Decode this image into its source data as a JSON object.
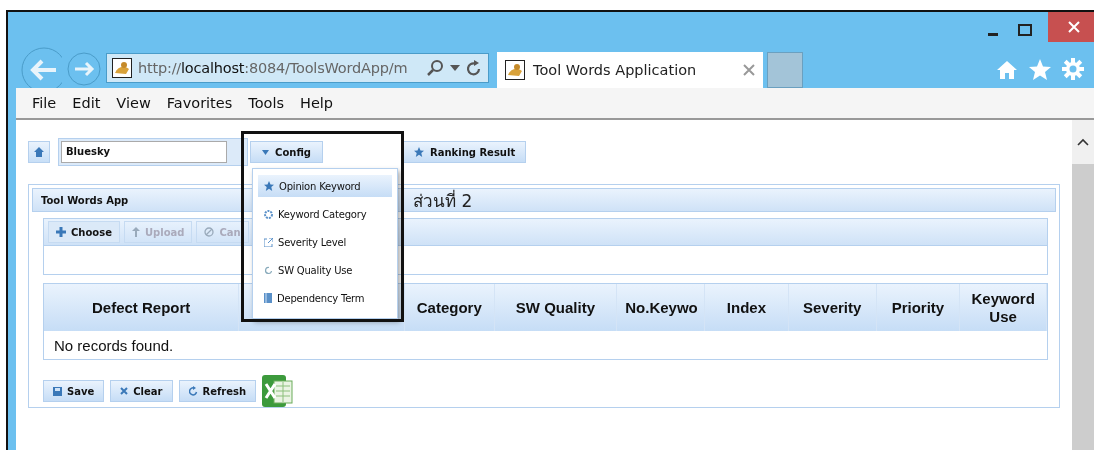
{
  "browser": {
    "address": "http://**localhost**:8084/ToolsWordApp/m",
    "tabs": [
      {
        "title": "Tool Words Application",
        "selected": true
      }
    ],
    "menu": [
      "File",
      "Edit",
      "View",
      "Favorites",
      "Tools",
      "Help"
    ]
  },
  "toolbar": {
    "combo_value": "Bluesky",
    "buttons": [
      {
        "label": "Config",
        "kind": "menu"
      },
      {
        "label": "Ranking Result",
        "kind": "star"
      }
    ]
  },
  "dropdown": {
    "items": [
      {
        "label": "Opinion Keyword",
        "kind": "star",
        "selected": true
      },
      {
        "label": "Keyword Category",
        "kind": "gear",
        "selected": false
      },
      {
        "label": "Severity Level",
        "kind": "link",
        "selected": false
      },
      {
        "label": "SW Quality Use",
        "kind": "cycle",
        "selected": false
      },
      {
        "label": "Dependency Term",
        "kind": "book",
        "selected": false
      }
    ]
  },
  "annotation": {
    "label": "ส่วนที่ 2"
  },
  "panel": {
    "title": "Tool Words App",
    "upload_buttons": [
      {
        "label": "Choose",
        "kind": "plus",
        "disabled": false
      },
      {
        "label": "Upload",
        "kind": "upload",
        "disabled": true
      },
      {
        "label": "Can",
        "kind": "cancel",
        "disabled": true
      }
    ],
    "table": {
      "columns": [
        "Defect Report",
        "Category",
        "SW Quality",
        "No.Keywo",
        "Index",
        "Severity",
        "Priority",
        "Keyword Use"
      ],
      "empty_message": "No records found."
    },
    "actions": [
      {
        "label": "Save",
        "kind": "save"
      },
      {
        "label": "Clear",
        "kind": "clear"
      },
      {
        "label": "Refresh",
        "kind": "refresh"
      }
    ]
  }
}
